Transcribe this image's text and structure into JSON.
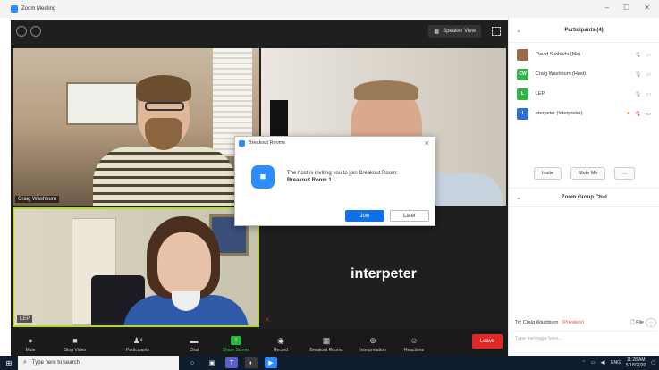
{
  "window": {
    "title": "Zoom Meeting"
  },
  "top_bar": {
    "speaker_view_label": "Speaker View"
  },
  "videos": {
    "tile1_name": "Craig Washburn",
    "tile3_name": "LEP",
    "tile4_big_name": "interpeter"
  },
  "toolbar": {
    "mute": "Mute",
    "stop_video": "Stop Video",
    "participants": "Participants",
    "participants_count": "4",
    "chat": "Chat",
    "share_screen": "Share Screen",
    "record": "Record",
    "breakout_rooms": "Breakout Rooms",
    "interpretation": "Interpretation",
    "reactions": "Reactions",
    "leave": "Leave"
  },
  "participants_panel": {
    "title": "Participants (4)",
    "items": [
      {
        "name": "David Svoboda (Me)",
        "initials": "",
        "color": "#9b6a4a"
      },
      {
        "name": "Craig Washburn (Host)",
        "initials": "CW",
        "color": "#36b24a"
      },
      {
        "name": "LEP",
        "initials": "L",
        "color": "#36b24a"
      },
      {
        "name": "eterpeter (Interpreter)",
        "initials": "I",
        "color": "#2d6fd6"
      }
    ],
    "invite": "Invite",
    "mute_me": "Mute Me",
    "more": "..."
  },
  "chat_panel": {
    "title": "Zoom Group Chat",
    "to_label": "To: Craig Washburn",
    "privately": "(Privately)",
    "file": "File",
    "placeholder": "Type message here..."
  },
  "dialog": {
    "title": "Breakout Rooms",
    "message": "The host is inviting you to join Breakout Room:",
    "room": "Breakout Room 1",
    "join": "Join",
    "later": "Later"
  },
  "taskbar": {
    "search_placeholder": "Type here to search",
    "lang": "ENG",
    "time": "11:28 AM",
    "date": "5/18/2020"
  }
}
